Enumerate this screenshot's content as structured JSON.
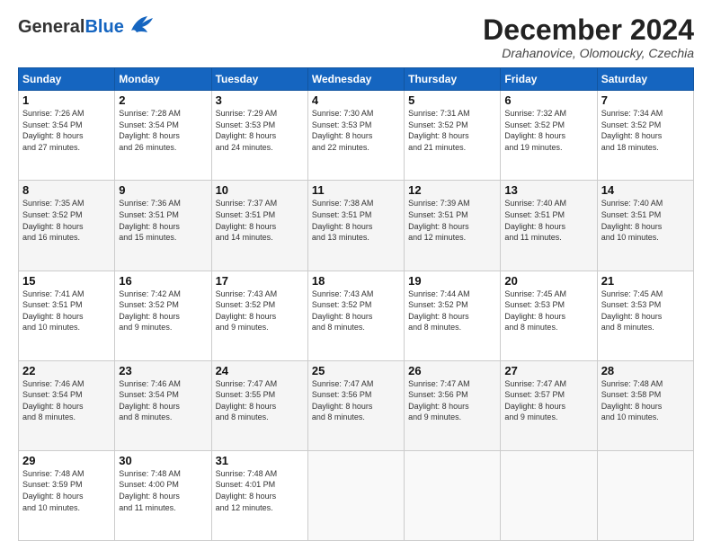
{
  "header": {
    "logo_general": "General",
    "logo_blue": "Blue",
    "month_title": "December 2024",
    "subtitle": "Drahanovice, Olomoucky, Czechia"
  },
  "days_of_week": [
    "Sunday",
    "Monday",
    "Tuesday",
    "Wednesday",
    "Thursday",
    "Friday",
    "Saturday"
  ],
  "weeks": [
    [
      {
        "day": "1",
        "info": "Sunrise: 7:26 AM\nSunset: 3:54 PM\nDaylight: 8 hours\nand 27 minutes."
      },
      {
        "day": "2",
        "info": "Sunrise: 7:28 AM\nSunset: 3:54 PM\nDaylight: 8 hours\nand 26 minutes."
      },
      {
        "day": "3",
        "info": "Sunrise: 7:29 AM\nSunset: 3:53 PM\nDaylight: 8 hours\nand 24 minutes."
      },
      {
        "day": "4",
        "info": "Sunrise: 7:30 AM\nSunset: 3:53 PM\nDaylight: 8 hours\nand 22 minutes."
      },
      {
        "day": "5",
        "info": "Sunrise: 7:31 AM\nSunset: 3:52 PM\nDaylight: 8 hours\nand 21 minutes."
      },
      {
        "day": "6",
        "info": "Sunrise: 7:32 AM\nSunset: 3:52 PM\nDaylight: 8 hours\nand 19 minutes."
      },
      {
        "day": "7",
        "info": "Sunrise: 7:34 AM\nSunset: 3:52 PM\nDaylight: 8 hours\nand 18 minutes."
      }
    ],
    [
      {
        "day": "8",
        "info": "Sunrise: 7:35 AM\nSunset: 3:52 PM\nDaylight: 8 hours\nand 16 minutes."
      },
      {
        "day": "9",
        "info": "Sunrise: 7:36 AM\nSunset: 3:51 PM\nDaylight: 8 hours\nand 15 minutes."
      },
      {
        "day": "10",
        "info": "Sunrise: 7:37 AM\nSunset: 3:51 PM\nDaylight: 8 hours\nand 14 minutes."
      },
      {
        "day": "11",
        "info": "Sunrise: 7:38 AM\nSunset: 3:51 PM\nDaylight: 8 hours\nand 13 minutes."
      },
      {
        "day": "12",
        "info": "Sunrise: 7:39 AM\nSunset: 3:51 PM\nDaylight: 8 hours\nand 12 minutes."
      },
      {
        "day": "13",
        "info": "Sunrise: 7:40 AM\nSunset: 3:51 PM\nDaylight: 8 hours\nand 11 minutes."
      },
      {
        "day": "14",
        "info": "Sunrise: 7:40 AM\nSunset: 3:51 PM\nDaylight: 8 hours\nand 10 minutes."
      }
    ],
    [
      {
        "day": "15",
        "info": "Sunrise: 7:41 AM\nSunset: 3:51 PM\nDaylight: 8 hours\nand 10 minutes."
      },
      {
        "day": "16",
        "info": "Sunrise: 7:42 AM\nSunset: 3:52 PM\nDaylight: 8 hours\nand 9 minutes."
      },
      {
        "day": "17",
        "info": "Sunrise: 7:43 AM\nSunset: 3:52 PM\nDaylight: 8 hours\nand 9 minutes."
      },
      {
        "day": "18",
        "info": "Sunrise: 7:43 AM\nSunset: 3:52 PM\nDaylight: 8 hours\nand 8 minutes."
      },
      {
        "day": "19",
        "info": "Sunrise: 7:44 AM\nSunset: 3:52 PM\nDaylight: 8 hours\nand 8 minutes."
      },
      {
        "day": "20",
        "info": "Sunrise: 7:45 AM\nSunset: 3:53 PM\nDaylight: 8 hours\nand 8 minutes."
      },
      {
        "day": "21",
        "info": "Sunrise: 7:45 AM\nSunset: 3:53 PM\nDaylight: 8 hours\nand 8 minutes."
      }
    ],
    [
      {
        "day": "22",
        "info": "Sunrise: 7:46 AM\nSunset: 3:54 PM\nDaylight: 8 hours\nand 8 minutes."
      },
      {
        "day": "23",
        "info": "Sunrise: 7:46 AM\nSunset: 3:54 PM\nDaylight: 8 hours\nand 8 minutes."
      },
      {
        "day": "24",
        "info": "Sunrise: 7:47 AM\nSunset: 3:55 PM\nDaylight: 8 hours\nand 8 minutes."
      },
      {
        "day": "25",
        "info": "Sunrise: 7:47 AM\nSunset: 3:56 PM\nDaylight: 8 hours\nand 8 minutes."
      },
      {
        "day": "26",
        "info": "Sunrise: 7:47 AM\nSunset: 3:56 PM\nDaylight: 8 hours\nand 9 minutes."
      },
      {
        "day": "27",
        "info": "Sunrise: 7:47 AM\nSunset: 3:57 PM\nDaylight: 8 hours\nand 9 minutes."
      },
      {
        "day": "28",
        "info": "Sunrise: 7:48 AM\nSunset: 3:58 PM\nDaylight: 8 hours\nand 10 minutes."
      }
    ],
    [
      {
        "day": "29",
        "info": "Sunrise: 7:48 AM\nSunset: 3:59 PM\nDaylight: 8 hours\nand 10 minutes."
      },
      {
        "day": "30",
        "info": "Sunrise: 7:48 AM\nSunset: 4:00 PM\nDaylight: 8 hours\nand 11 minutes."
      },
      {
        "day": "31",
        "info": "Sunrise: 7:48 AM\nSunset: 4:01 PM\nDaylight: 8 hours\nand 12 minutes."
      },
      {
        "day": "",
        "info": ""
      },
      {
        "day": "",
        "info": ""
      },
      {
        "day": "",
        "info": ""
      },
      {
        "day": "",
        "info": ""
      }
    ]
  ]
}
